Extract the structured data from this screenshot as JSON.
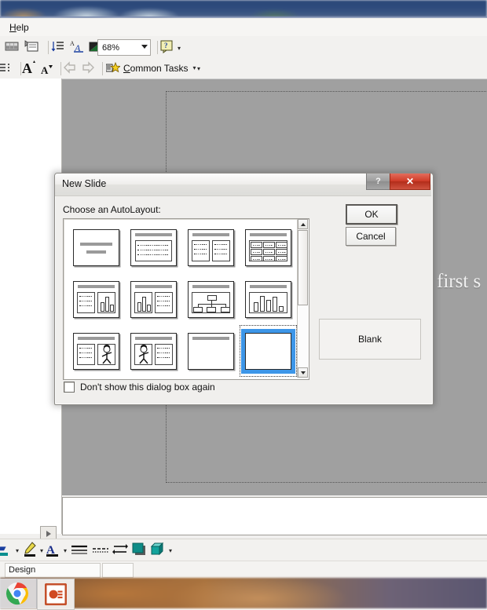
{
  "app": {
    "menubar": {
      "items": [
        {
          "label": "Help",
          "accel": "H"
        }
      ]
    },
    "toolbar_top": {
      "zoom_value": "68%",
      "icons": [
        {
          "name": "slide-sorter-icon",
          "glyph": "▥"
        },
        {
          "name": "notes-page-icon",
          "glyph": "▤"
        },
        {
          "name": "line-spacing-icon",
          "glyph": "↧"
        },
        {
          "name": "font-color-icon",
          "glyph": "A"
        },
        {
          "name": "show-formatting-icon",
          "glyph": "◩"
        },
        {
          "name": "help-question-icon",
          "glyph": "?"
        }
      ]
    },
    "toolbar_second": {
      "common_tasks_label": "Common Tasks",
      "icons": [
        {
          "name": "outline-collapse-icon",
          "glyph": "☰"
        },
        {
          "name": "increase-font-size-icon",
          "glyph": "A"
        },
        {
          "name": "decrease-font-size-icon",
          "glyph": "A"
        },
        {
          "name": "promote-arrow-icon",
          "glyph": "⇦"
        },
        {
          "name": "demote-arrow-icon",
          "glyph": "⇨"
        },
        {
          "name": "common-tasks-star-icon",
          "glyph": "★"
        }
      ]
    },
    "drawing_toolbar": {
      "icons": [
        {
          "name": "fill-color-icon",
          "glyph": "▰"
        },
        {
          "name": "line-color-icon",
          "glyph": "✎"
        },
        {
          "name": "font-color-icon",
          "glyph": "A"
        },
        {
          "name": "line-style-icon",
          "glyph": "≡"
        },
        {
          "name": "dash-style-icon",
          "glyph": "┄"
        },
        {
          "name": "arrow-style-icon",
          "glyph": "⇄"
        },
        {
          "name": "shadow-style-icon",
          "glyph": "▣"
        },
        {
          "name": "3d-style-icon",
          "glyph": "◳"
        }
      ]
    },
    "statusbar": {
      "design_label": "Design",
      "second_box_value": ""
    },
    "slide_area": {
      "slide_text": "first s"
    },
    "taskbar": {
      "buttons": [
        {
          "name": "taskbar-chrome",
          "label": "Chrome"
        },
        {
          "name": "taskbar-powerpoint",
          "label": "PowerPoint"
        }
      ]
    }
  },
  "dialog": {
    "title": "New Slide",
    "help_button": "?",
    "close_button": "✕",
    "autolayout_label": "Choose an AutoLayout:",
    "ok_label": "OK",
    "cancel_label": "Cancel",
    "preview_label": "Blank",
    "dont_show_label": "Don't show this dialog box again",
    "dont_show_checked": false,
    "selected_index": 11,
    "accent_selection_color": "#3d96e8",
    "layouts": [
      {
        "index": 0,
        "name": "Title Slide"
      },
      {
        "index": 1,
        "name": "Bulleted List"
      },
      {
        "index": 2,
        "name": "2 Column Text"
      },
      {
        "index": 3,
        "name": "Table"
      },
      {
        "index": 4,
        "name": "Text & Chart"
      },
      {
        "index": 5,
        "name": "Chart & Text"
      },
      {
        "index": 6,
        "name": "Organization Chart"
      },
      {
        "index": 7,
        "name": "Chart"
      },
      {
        "index": 8,
        "name": "Text & Clip Art"
      },
      {
        "index": 9,
        "name": "Clip Art & Text"
      },
      {
        "index": 10,
        "name": "Title Only"
      },
      {
        "index": 11,
        "name": "Blank"
      }
    ],
    "scrollbar": {
      "name": "layout-scrollbar",
      "up_arrow": "▲",
      "down_arrow": "▼"
    }
  }
}
